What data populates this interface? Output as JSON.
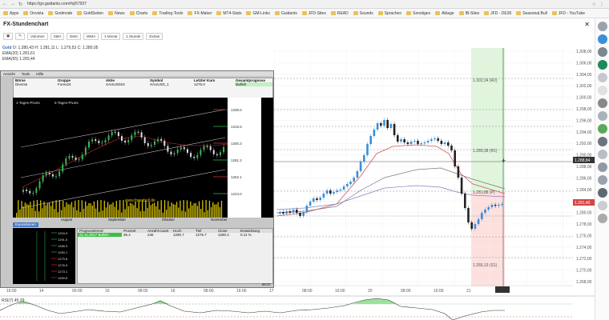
{
  "browser": {
    "url": "https://go.guidants.com/#q/57937",
    "bookmarks": [
      "Apps",
      "Onvista",
      "Godmode",
      "GoldSeiten",
      "News",
      "Charts",
      "Trading-Tools",
      "FX-Maker",
      "MT4-Stats",
      "GM-Links",
      "Guidants",
      "JFD-Sites",
      "READ",
      "Sounds",
      "Sprachen",
      "Sonstiges",
      "Ablage",
      "IB-Sites",
      "JFD - DE30",
      "Seasonal.Bull",
      "JFD - YouTube"
    ]
  },
  "app": {
    "title": "FX-Stundenchart",
    "close_label": "✕",
    "toolbar": [
      "Volumen",
      "SMA",
      "EMA",
      "WMA",
      "1 Monat",
      "1 Stunde",
      "Extras"
    ]
  },
  "legend": {
    "symbol": "Gold",
    "ohlc": "O: 1.280,43  H: 1.281,11  L: 1.279,53  C: 1.280,05",
    "ema20": "EMA(20)  1.281,61",
    "ema55": "EMA(55)  1.283,44"
  },
  "price_axis": [
    "1.308,00",
    "1.306,00",
    "1.304,00",
    "1.302,00",
    "1.300,00",
    "1.298,00",
    "1.296,00",
    "1.294,00",
    "1.292,00",
    "1.290,00",
    "1.288,00",
    "1.286,00",
    "1.284,00",
    "1.282,00",
    "1.280,00",
    "1.278,00",
    "1.276,00",
    "1.274,00",
    "1.272,00",
    "1.270,00",
    "1.268,00"
  ],
  "current_price": "1.288,84",
  "current_tag": "1.281,40",
  "levels": {
    "r2": "1.302,34 (R2)",
    "r1": "1.289,38 (R1)",
    "pp": "1.281,88 (P)",
    "s1": "1.269,13 (S1)"
  },
  "time_axis": [
    "16:00",
    "14",
    "00:00",
    "15",
    "08:00",
    "16",
    "08:00",
    "16:00",
    "17",
    "08:00",
    "16:00",
    "20",
    "08:00",
    "16:00",
    "21",
    "08:00"
  ],
  "rsi_label": "RSI(7)  45,39",
  "embedded": {
    "menu": [
      "Ansicht",
      "Tools",
      "Hilfe"
    ],
    "headers": [
      "Börse",
      "Gruppe",
      "Aktie",
      "Symbol",
      "Letzter Kurs",
      "Gesamtprognose"
    ],
    "values": [
      "Diverse",
      "Forex24",
      "XAUUSD24",
      "XAUUSD_1",
      "1276.0",
      "Bullish"
    ],
    "chart_legend": [
      "1-Tages-Pivots",
      "5-Tages-Pivots"
    ],
    "chart_levels": [
      "1338.6",
      "1319.5",
      "1300.3",
      "1281.2",
      "1262.1",
      "1243.0"
    ],
    "watermark": "www.forexbull.de",
    "months": [
      "August",
      "September",
      "Oktober",
      "November"
    ],
    "status_tab": "Expositionen",
    "table_headers": [
      "Prognosetrend",
      "Prozent",
      "Anzahl-count",
      "Hoch",
      "Tief",
      "Close",
      "Entwicklung"
    ],
    "table_row": [
      "21.11.2017 Bullish",
      "35.4",
      "246",
      "1290.7",
      "1275.7",
      "1280.4",
      "0.11 %"
    ],
    "mini_levels": [
      "1294.9",
      "1291.5",
      "1288.3",
      "1283.1",
      "1279.8",
      "1276.5",
      "1273.1",
      "1269.8"
    ],
    "time": "08:37"
  }
}
